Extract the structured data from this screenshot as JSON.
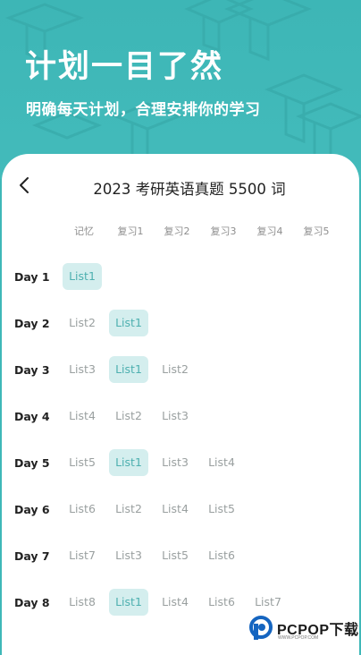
{
  "hero": {
    "title": "计划一目了然",
    "subtitle": "明确每天计划，合理安排你的学习"
  },
  "header": {
    "back_icon": "chevron-left-icon",
    "title": "2023 考研英语真题 5500 词"
  },
  "columns": [
    "记忆",
    "复习1",
    "复习2",
    "复习3",
    "复习4",
    "复习5"
  ],
  "days": [
    {
      "label": "Day 1",
      "cells": [
        {
          "text": "List1",
          "active": true
        }
      ]
    },
    {
      "label": "Day 2",
      "cells": [
        {
          "text": "List2",
          "active": false
        },
        {
          "text": "List1",
          "active": true
        }
      ]
    },
    {
      "label": "Day 3",
      "cells": [
        {
          "text": "List3",
          "active": false
        },
        {
          "text": "List1",
          "active": true
        },
        {
          "text": "List2",
          "active": false
        }
      ]
    },
    {
      "label": "Day 4",
      "cells": [
        {
          "text": "List4",
          "active": false
        },
        {
          "text": "List2",
          "active": false
        },
        {
          "text": "List3",
          "active": false
        }
      ]
    },
    {
      "label": "Day 5",
      "cells": [
        {
          "text": "List5",
          "active": false
        },
        {
          "text": "List1",
          "active": true
        },
        {
          "text": "List3",
          "active": false
        },
        {
          "text": "List4",
          "active": false
        }
      ]
    },
    {
      "label": "Day 6",
      "cells": [
        {
          "text": "List6",
          "active": false
        },
        {
          "text": "List2",
          "active": false
        },
        {
          "text": "List4",
          "active": false
        },
        {
          "text": "List5",
          "active": false
        }
      ]
    },
    {
      "label": "Day 7",
      "cells": [
        {
          "text": "List7",
          "active": false
        },
        {
          "text": "List3",
          "active": false
        },
        {
          "text": "List5",
          "active": false
        },
        {
          "text": "List6",
          "active": false
        }
      ]
    },
    {
      "label": "Day 8",
      "cells": [
        {
          "text": "List8",
          "active": false
        },
        {
          "text": "List1",
          "active": true
        },
        {
          "text": "List4",
          "active": false
        },
        {
          "text": "List6",
          "active": false
        },
        {
          "text": "List7",
          "active": false
        }
      ]
    }
  ],
  "watermark": {
    "text": "PCPOP下载",
    "sub": "WWW.PCPOP.COM"
  },
  "colors": {
    "hero_bg": "#3fb8b8",
    "active_cell_bg": "#d4eeee",
    "active_cell_text": "#4eb0b0",
    "watermark_blue": "#1565c0"
  }
}
